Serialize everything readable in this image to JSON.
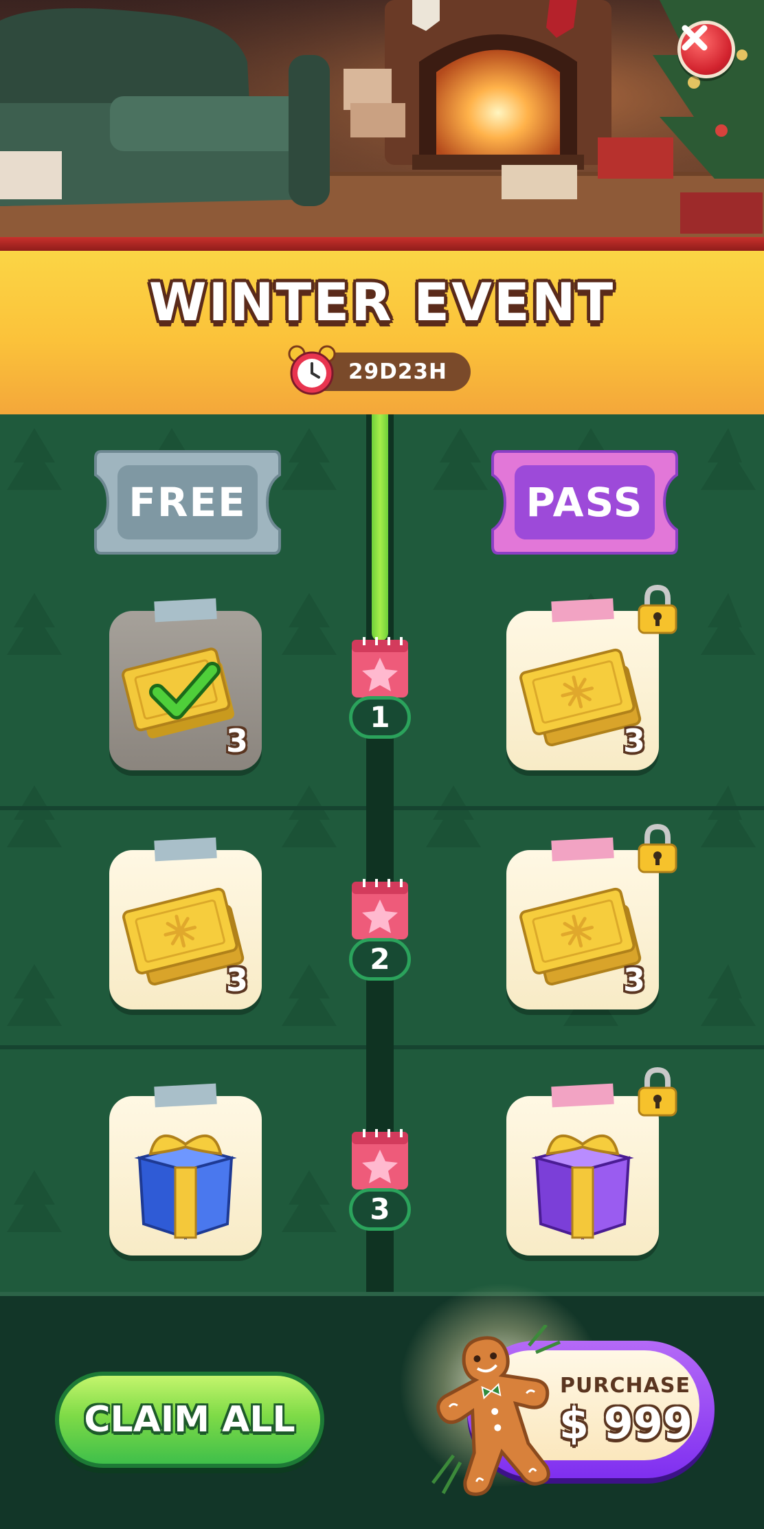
{
  "header": {
    "title": "WINTER EVENT",
    "timer": "29D23H",
    "close_icon": "close-icon",
    "clock_icon": "alarm-clock-icon"
  },
  "tracks": {
    "free_label": "FREE",
    "pass_label": "PASS",
    "colors": {
      "free": "#9fb5bf",
      "pass": "#b466e8",
      "progress": "#8be03f"
    }
  },
  "levels": [
    {
      "level": "1",
      "free": {
        "reward": "ticket",
        "icon": "golden-ticket-icon",
        "quantity": "3",
        "claimed": true
      },
      "pass": {
        "reward": "ticket",
        "icon": "golden-ticket-icon",
        "quantity": "3",
        "locked": true
      }
    },
    {
      "level": "2",
      "free": {
        "reward": "ticket",
        "icon": "golden-ticket-icon",
        "quantity": "3",
        "claimed": false
      },
      "pass": {
        "reward": "ticket",
        "icon": "golden-ticket-icon",
        "quantity": "3",
        "locked": true
      }
    },
    {
      "level": "3",
      "free": {
        "reward": "gift",
        "icon": "blue-gift-box-icon",
        "claimed": false
      },
      "pass": {
        "reward": "gift",
        "icon": "purple-gift-box-icon",
        "locked": true
      }
    }
  ],
  "progress": {
    "completed_levels": 1
  },
  "footer": {
    "claim_all_label": "CLAIM ALL",
    "purchase_label": "PURCHASE",
    "purchase_price": "$ 999",
    "purchase_icon": "gingerbread-man-icon"
  }
}
